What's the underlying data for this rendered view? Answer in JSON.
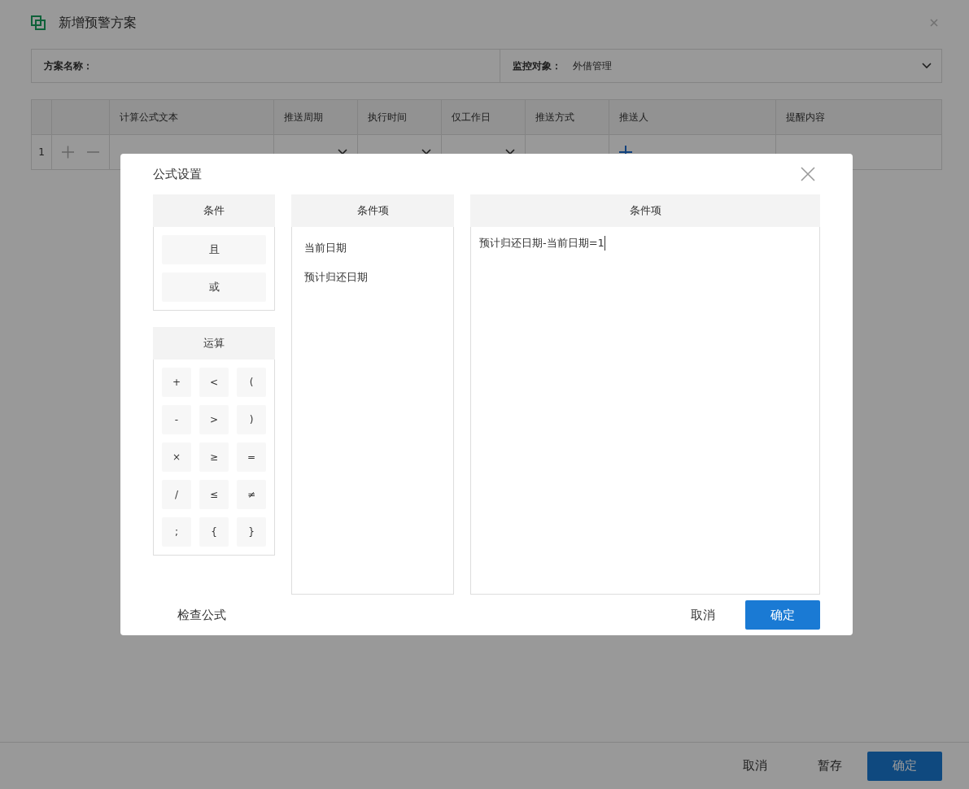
{
  "window": {
    "title": "新增预警方案"
  },
  "form": {
    "name_label": "方案名称：",
    "target_label": "监控对象：",
    "target_value": "外借管理"
  },
  "table": {
    "columns": [
      "计算公式文本",
      "推送周期",
      "执行时间",
      "仅工作日",
      "推送方式",
      "推送人",
      "提醒内容"
    ],
    "rows": [
      {
        "index": "1",
        "cells": [
          {
            "kind": "empty"
          },
          {
            "kind": "select"
          },
          {
            "kind": "select"
          },
          {
            "kind": "select"
          },
          {
            "kind": "empty"
          },
          {
            "kind": "add"
          },
          {
            "kind": "empty"
          }
        ]
      }
    ]
  },
  "footer_buttons": [
    {
      "label": "取消",
      "kind": "plain"
    },
    {
      "label": "暂存",
      "kind": "plain"
    },
    {
      "label": "确定",
      "kind": "primary"
    }
  ],
  "dialog": {
    "title": "公式设置",
    "conditions": {
      "title": "条件",
      "items": [
        "且",
        "或"
      ]
    },
    "operations": {
      "title": "运算",
      "items": [
        "+",
        "<",
        "(",
        "-",
        ">",
        ")",
        "×",
        "≥",
        "=",
        "/",
        "≤",
        "≠",
        ";",
        "{",
        "}"
      ]
    },
    "fields": {
      "title": "条件项",
      "items": [
        "当前日期",
        "预计归还日期"
      ]
    },
    "formula": {
      "title": "条件项",
      "value": "预计归还日期-当前日期=1"
    },
    "check_link": "检查公式",
    "buttons": [
      {
        "label": "取消",
        "kind": "plain"
      },
      {
        "label": "确定",
        "kind": "primary"
      }
    ]
  }
}
